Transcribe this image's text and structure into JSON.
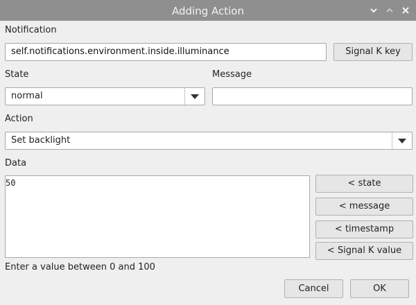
{
  "window": {
    "title": "Adding Action",
    "controls": [
      "chevron-down-icon",
      "chevron-up-icon",
      "close-icon"
    ]
  },
  "notification": {
    "label": "Notification",
    "value": "self.notifications.environment.inside.illuminance",
    "key_button": "Signal K key"
  },
  "state": {
    "label": "State",
    "selected": "normal"
  },
  "message": {
    "label": "Message",
    "value": ""
  },
  "action": {
    "label": "Action",
    "selected": "Set backlight"
  },
  "data": {
    "label": "Data",
    "value": "50",
    "insert_buttons": [
      "< state",
      "< message",
      "< timestamp",
      "< Signal K value"
    ],
    "hint": "Enter a value between 0 and 100"
  },
  "footer": {
    "cancel": "Cancel",
    "ok": "OK"
  },
  "colors": {
    "titlebar": "#8f8f8f",
    "background": "#efefef"
  }
}
